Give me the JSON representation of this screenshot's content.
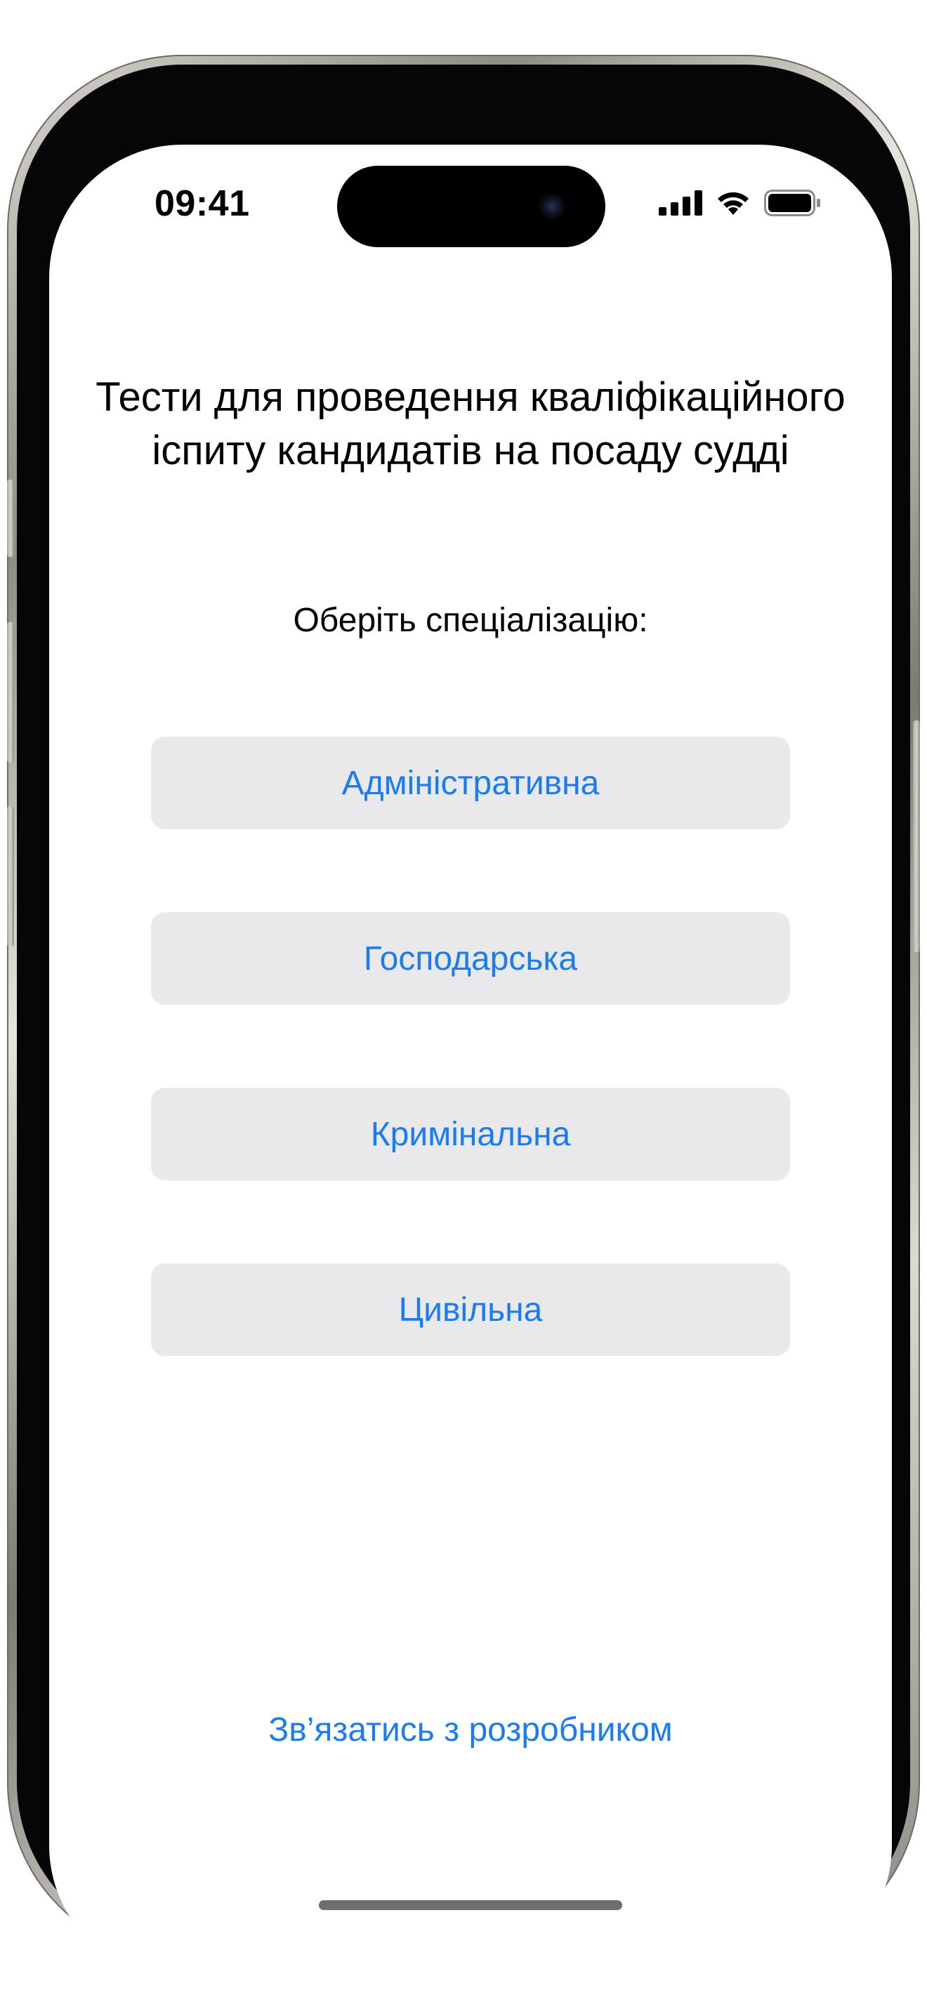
{
  "status_bar": {
    "time": "09:41",
    "icons": [
      "cellular-signal-icon",
      "wifi-icon",
      "battery-icon"
    ]
  },
  "screen": {
    "title_line1": "Тести для проведення кваліфікаційного",
    "title_line2": "іспиту кандидатів на посаду судді",
    "prompt": "Оберіть спеціалізацію:",
    "specializations": [
      {
        "label": "Адміністративна"
      },
      {
        "label": "Господарська"
      },
      {
        "label": "Кримінальна"
      },
      {
        "label": "Цивільна"
      }
    ],
    "contact_link": "Зв’язатись з розробником"
  },
  "colors": {
    "accent": "#1b7cf0",
    "button_bg": "#e9e9eb",
    "text": "#000000"
  }
}
